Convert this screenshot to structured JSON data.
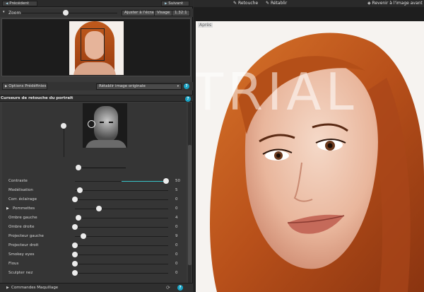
{
  "nav": {
    "prev_label": "Précédent",
    "next_label": "Suivant"
  },
  "zoom": {
    "label": "Zoom",
    "fit_label": "Ajuster à l'écran",
    "face_label": "Visage",
    "value": "1.32:1",
    "level": 0.45
  },
  "presets": {
    "button_label": "Options Prédéfinies",
    "select_value": "Rétablir image originale"
  },
  "section": {
    "title": "Curseurs de retouche du portrait"
  },
  "sliders": [
    {
      "label": "Contraste",
      "value": "50",
      "fraction": 0.98,
      "filled": true
    },
    {
      "label": "Modélisation",
      "value": "5",
      "fraction": 0.05
    },
    {
      "label": "Corr. éclairage",
      "value": "0",
      "fraction": 0.0
    },
    {
      "label": "Pommettes",
      "value": "0",
      "fraction": 0.26,
      "expandable": true
    },
    {
      "label": "Ombre gauche",
      "value": "4",
      "fraction": 0.04
    },
    {
      "label": "Ombre droite",
      "value": "0",
      "fraction": 0.0
    },
    {
      "label": "Projecteur gauche",
      "value": "9",
      "fraction": 0.09
    },
    {
      "label": "Projecteur droit",
      "value": "0",
      "fraction": 0.0
    },
    {
      "label": "Smokey eyes",
      "value": "0",
      "fraction": 0.0
    },
    {
      "label": "Flous",
      "value": "0",
      "fraction": 0.0
    },
    {
      "label": "Sculpter nez",
      "value": "0",
      "fraction": 0.0
    }
  ],
  "bottom": {
    "makeup_label": "Commandes Maquillage"
  },
  "topbar": {
    "retouch_label": "Retouche",
    "reset_label": "Rétablir",
    "revert_label": "Revenir à l'image avant"
  },
  "viewer": {
    "after_label": "Après",
    "watermark": "TRIAL"
  },
  "icons": {
    "help": "?",
    "triangle_right": "▶",
    "triangle_down": "▾",
    "triangle_left": "◀"
  }
}
